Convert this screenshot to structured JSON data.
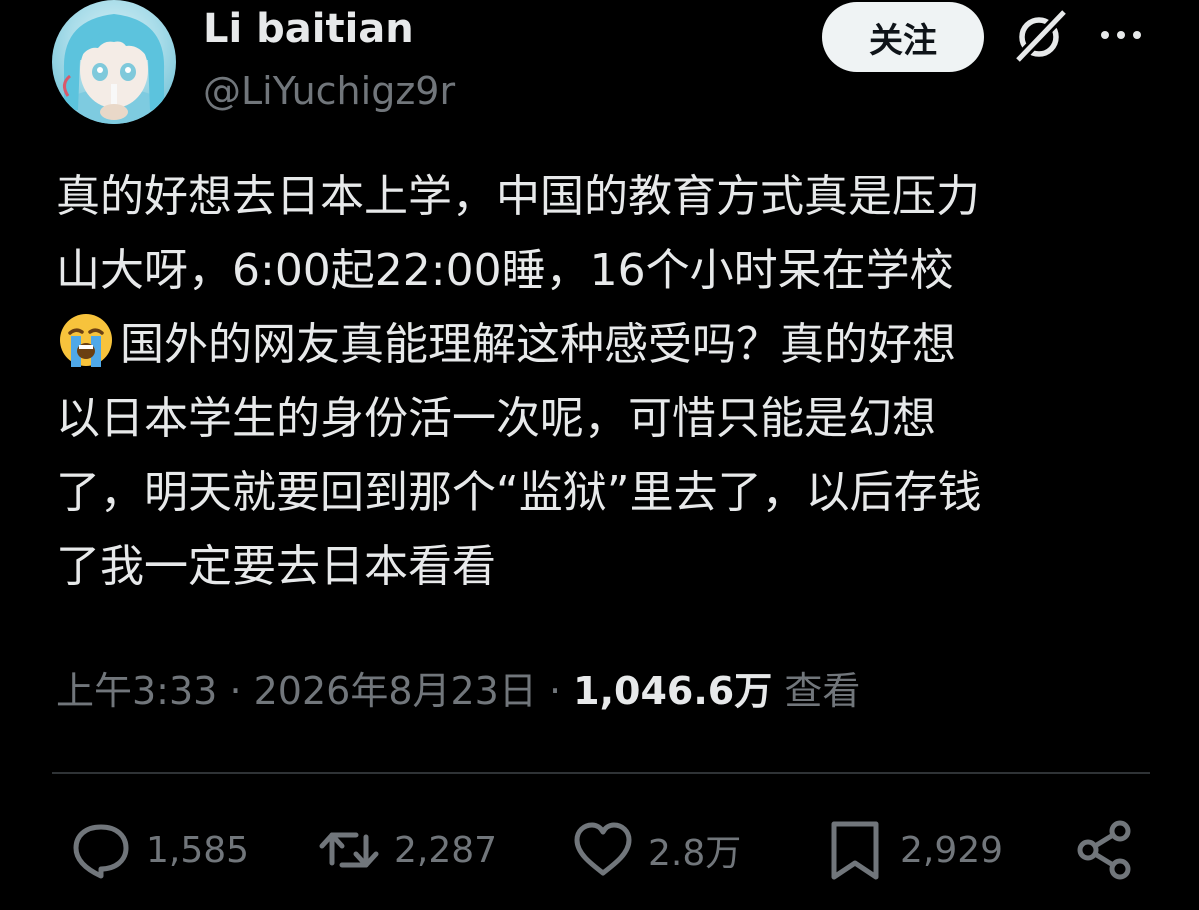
{
  "user": {
    "name": "Li baitian",
    "handle": "@LiYuchigz9r"
  },
  "header": {
    "follow_label": "关注"
  },
  "post": {
    "lines": [
      "真的好想去日本上学，中国的教育方式真是压力",
      "山大呀，6:00起22:00睡，16个小时呆在学校",
      "国外的网友真能理解这种感受吗？真的好想",
      "以日本学生的身份活一次呢，可惜只能是幻想",
      "了，明天就要回到那个“监狱”里去了，以后存钱",
      "了我一定要去日本看看"
    ],
    "emoji_name": "loudly-crying-face"
  },
  "meta": {
    "time": "上午3:33",
    "date": "2026年8月23日",
    "views_count": "1,046.6万",
    "views_label": "查看",
    "separator": "·"
  },
  "actions": {
    "replies": "1,585",
    "reposts": "2,287",
    "likes": "2.8万",
    "bookmarks": "2,929"
  },
  "colors": {
    "background": "#000000",
    "primary_text": "#e7e9ea",
    "secondary_text": "#71767b",
    "divider": "#2f3336",
    "follow_button_bg": "#eff3f4"
  }
}
